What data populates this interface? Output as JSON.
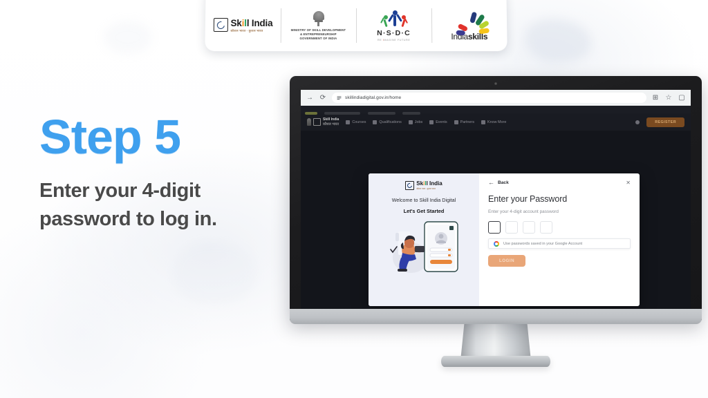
{
  "logo_bar": {
    "logos": [
      {
        "name": "Skill India",
        "title": "Skill India",
        "title_parts": {
          "pre": "Sk",
          "b1": "i",
          "b2": "l",
          "post": "l India"
        },
        "subtitle": "कौशल भारत - कुशल भारत"
      },
      {
        "name": "Ministry of Skill Development & Entrepreneurship",
        "line1": "MINISTRY OF SKILL DEVELOPMENT",
        "line2": "& ENTREPRENEURSHIP",
        "line3": "GOVERNMENT OF INDIA"
      },
      {
        "name": "NSDC",
        "title": "N·S·D·C",
        "tagline_pre": "RE ",
        "tagline_mark": "I",
        "tagline_post": "MAGINE FUTURE"
      },
      {
        "name": "India Skills",
        "title_light": "India",
        "title_bold": "skills"
      }
    ]
  },
  "copy": {
    "step_title": "Step 5",
    "step_subtitle": "Enter your 4-digit password to log in.",
    "accent_color": "#3fa0ee",
    "subtitle_color": "#4a4a4a"
  },
  "browser": {
    "forward_icon": "→",
    "reload_icon": "⟳",
    "site_info_icon": "site-settings-icon",
    "url": "skillindiadigital.gov.in/home",
    "extensions_icon": "⊞",
    "bookmark_icon": "☆",
    "profile_icon": "▢"
  },
  "site_nav": {
    "brand": "Skill India",
    "brand_sub": "कौशल भारत",
    "items": [
      {
        "label": "Courses"
      },
      {
        "label": "Qualifications"
      },
      {
        "label": "Jobs"
      },
      {
        "label": "Events"
      },
      {
        "label": "Partners"
      },
      {
        "label": "Know More"
      }
    ],
    "cta_label": "REGISTER",
    "cta_color": "#7a4a20"
  },
  "modal": {
    "back_label": "Back",
    "back_icon": "←",
    "close_icon": "✕",
    "left": {
      "brand": "Skill India",
      "brand_pre": "Sk",
      "brand_o": "i",
      "brand_g": "l",
      "brand_post": "l India",
      "brand_tagline": "कौशल भारत - कुशल भारत",
      "welcome": "Welcome to Skill India Digital",
      "get_started": "Let's Get Started"
    },
    "right": {
      "title": "Enter your Password",
      "hint": "Enter your 4-digit account password",
      "otp_boxes": [
        {
          "value": "",
          "focused": true
        },
        {
          "value": "",
          "focused": false
        },
        {
          "value": "",
          "focused": false
        },
        {
          "value": "",
          "focused": false
        }
      ],
      "google_suggestion": "Use passwords saved in your Google Account",
      "login_label": "LOGIN",
      "login_color": "#e9a678"
    }
  }
}
